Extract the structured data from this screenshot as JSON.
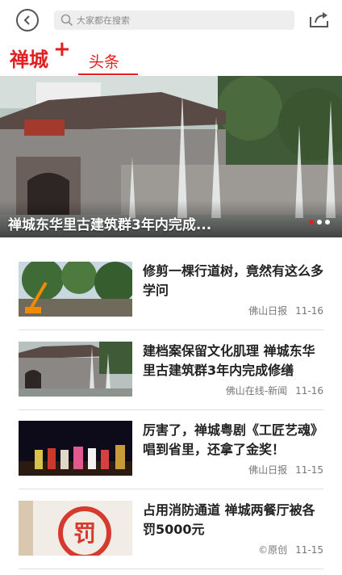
{
  "search": {
    "placeholder": "大家都在搜索"
  },
  "brand": {
    "name": "禅城",
    "plus": "+"
  },
  "tabs": [
    {
      "label": "头条",
      "active": true
    }
  ],
  "banner": {
    "caption": "禅城东华里古建筑群3年内完成...",
    "slide_count": 3,
    "active_slide": 1
  },
  "news": [
    {
      "title": "修剪一棵行道树，竟然有这么多学问",
      "source": "佛山日报",
      "date": "11-16"
    },
    {
      "title": "建档案保留文化肌理 禅城东华里古建筑群3年内完成修缮",
      "source": "佛山在线-新闻",
      "date": "11-16"
    },
    {
      "title": "厉害了，禅城粤剧《工匠艺魂》唱到省里，还拿了金奖！",
      "source": "佛山日报",
      "date": "11-15"
    },
    {
      "title": "占用消防通道 禅城两餐厅被各罚5000元",
      "source": "©原创",
      "date": "11-15",
      "thumb_text": "罚"
    }
  ],
  "colors": {
    "accent": "#e02020",
    "text": "#222222",
    "meta": "#777777",
    "search_bg": "#eeeeee"
  },
  "icons": {
    "back": "back-arrow-icon",
    "search": "search-icon",
    "share": "share-icon"
  }
}
